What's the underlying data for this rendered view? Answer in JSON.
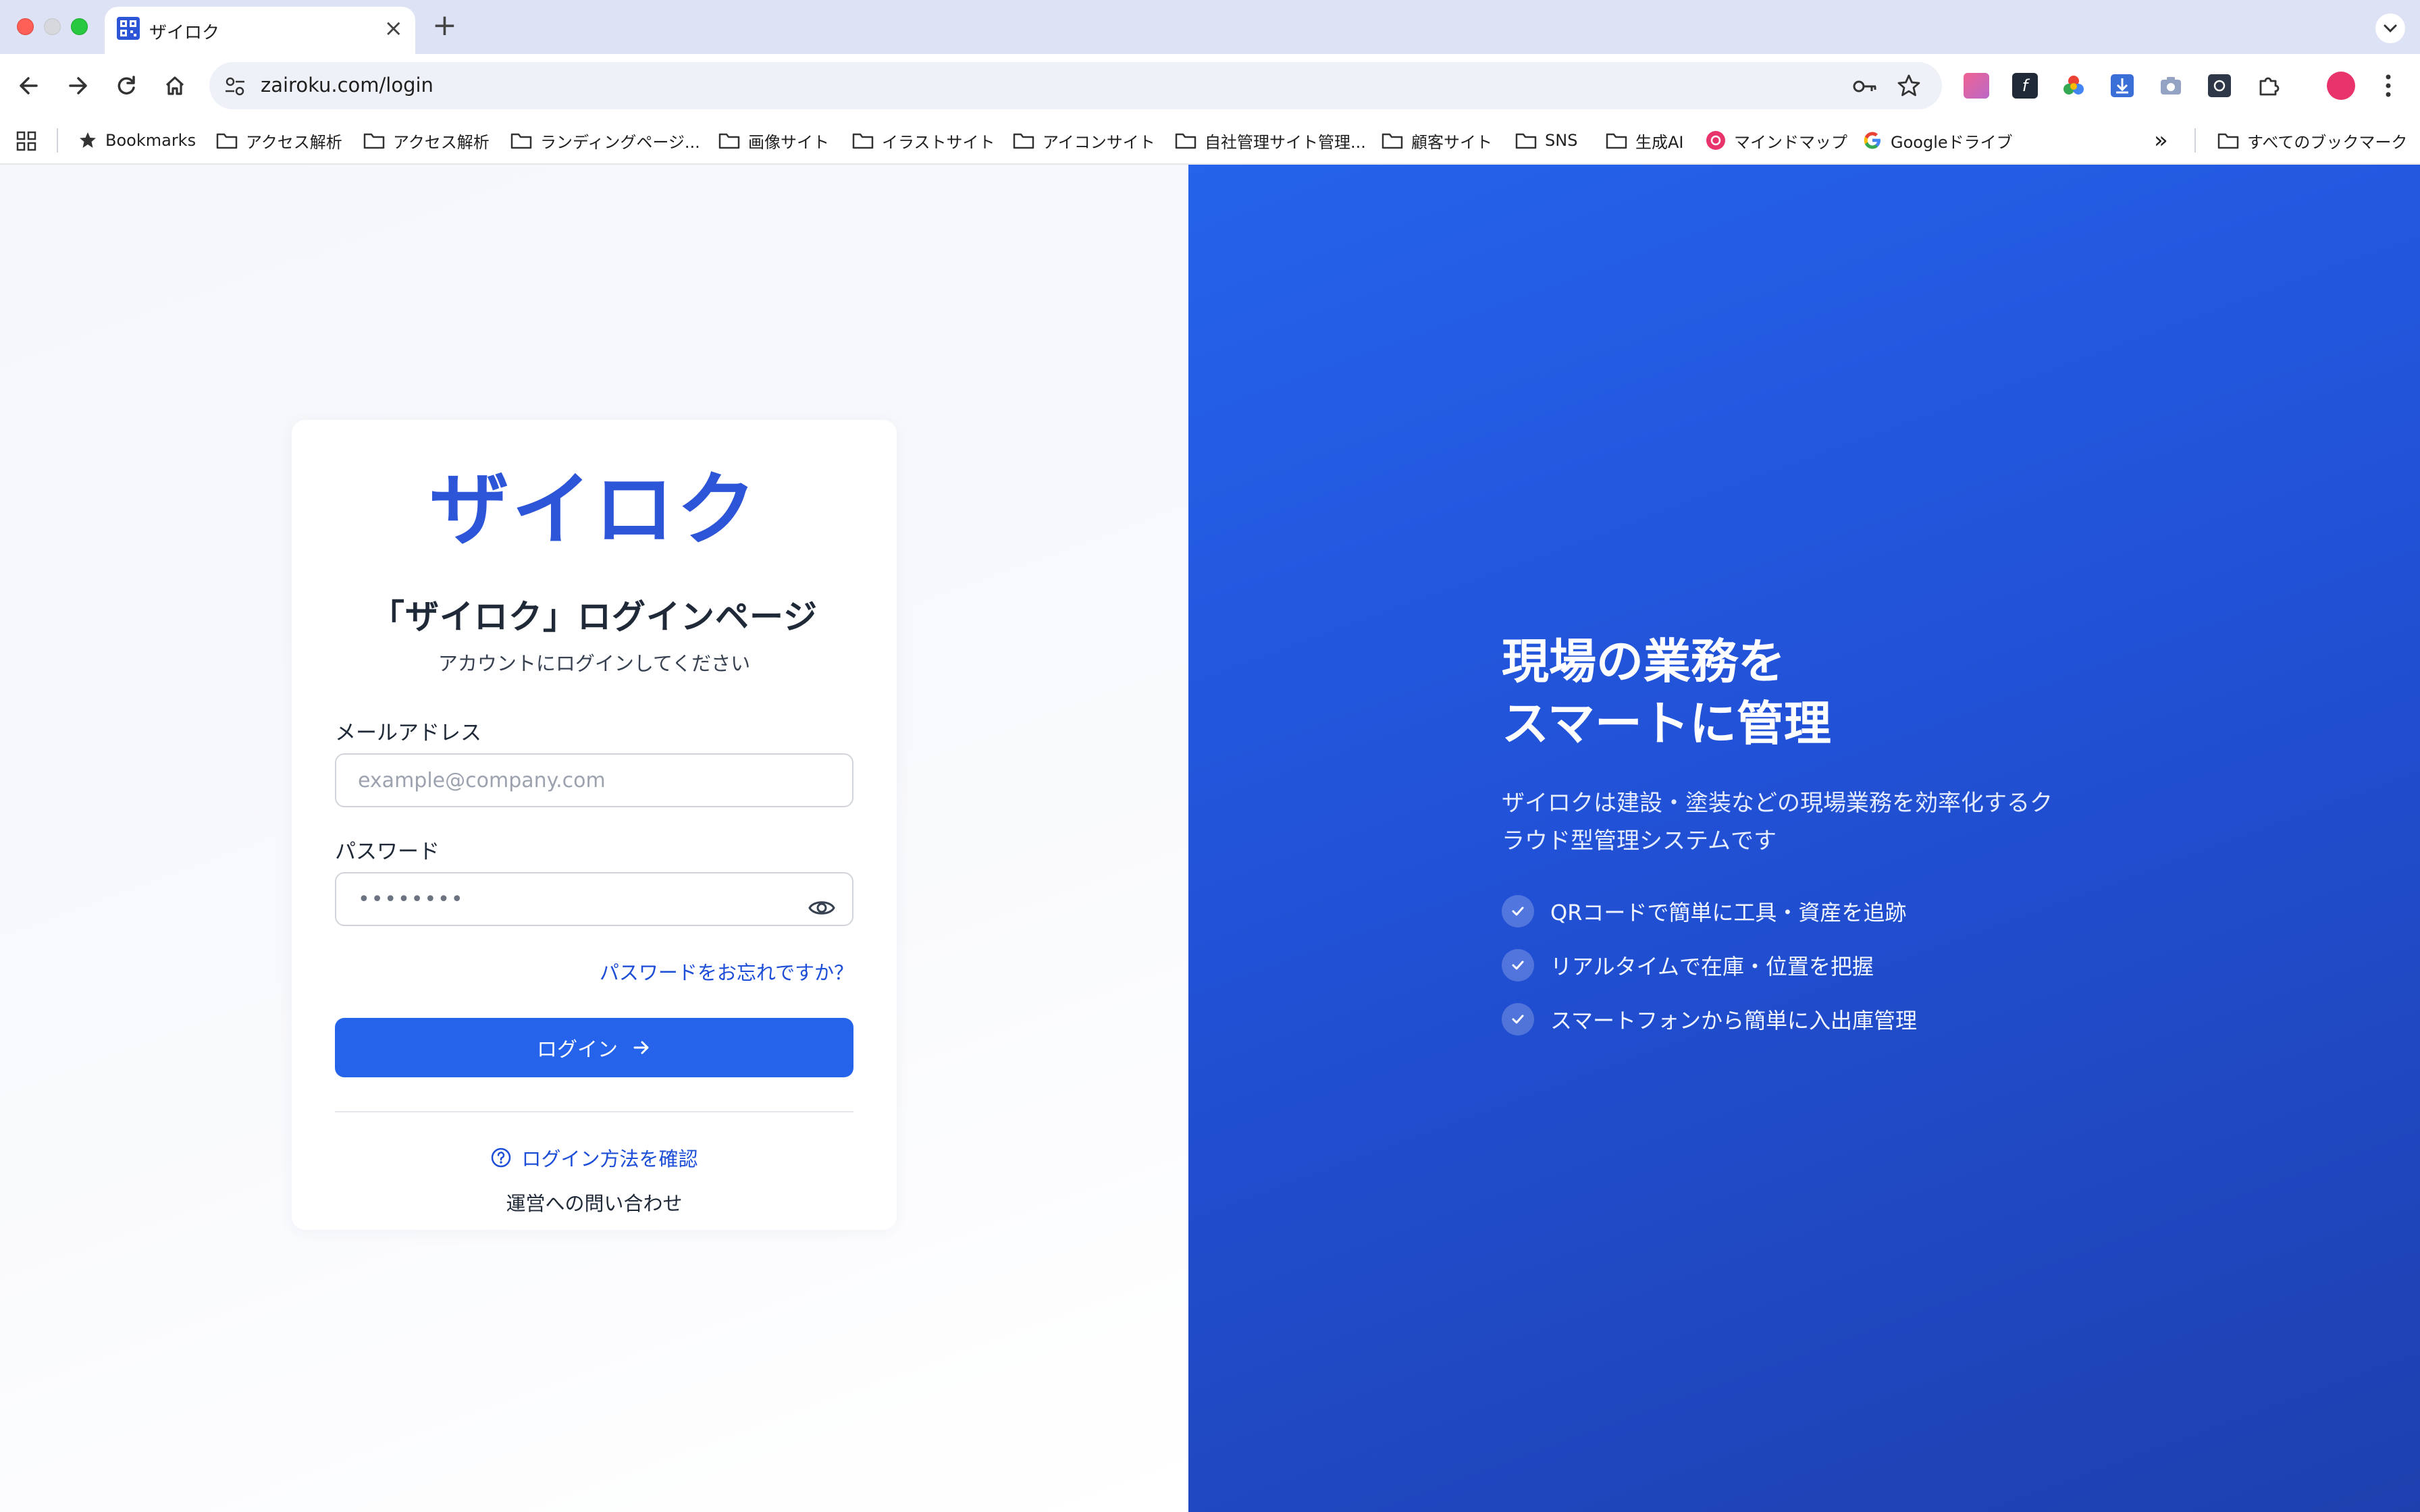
{
  "browser": {
    "tab_title": "ザイロク",
    "tab_close": "×",
    "new_tab": "+",
    "url": "zairoku.com/login",
    "bookmarks": [
      {
        "label": "Bookmarks",
        "icon": "star-icon"
      },
      {
        "label": "アクセス解析",
        "icon": "folder-icon"
      },
      {
        "label": "アクセス解析",
        "icon": "folder-icon"
      },
      {
        "label": "ランディングページ...",
        "icon": "folder-icon"
      },
      {
        "label": "画像サイト",
        "icon": "folder-icon"
      },
      {
        "label": "イラストサイト",
        "icon": "folder-icon"
      },
      {
        "label": "アイコンサイト",
        "icon": "folder-icon"
      },
      {
        "label": "自社管理サイト管理...",
        "icon": "folder-icon"
      },
      {
        "label": "顧客サイト",
        "icon": "folder-icon"
      },
      {
        "label": "SNS",
        "icon": "folder-icon"
      },
      {
        "label": "生成AI",
        "icon": "folder-icon"
      },
      {
        "label": "マインドマップ",
        "icon": "mindmap-icon"
      },
      {
        "label": "Googleドライブ",
        "icon": "google-icon"
      }
    ],
    "all_bookmarks": "すべてのブックマーク",
    "overflow": "»"
  },
  "login": {
    "logo_text": "ザイロク",
    "title": "「ザイロク」ログインページ",
    "subtitle": "アカウントにログインしてください",
    "email_label": "メールアドレス",
    "email_placeholder": "example@company.com",
    "password_label": "パスワード",
    "password_value": "••••••••",
    "forgot": "パスワードをお忘れですか？",
    "submit": "ログイン",
    "howto": "ログイン方法を確認",
    "contact": "運営への問い合わせ"
  },
  "hero": {
    "title_line1": "現場の業務を",
    "title_line2": "スマートに管理",
    "desc_line1": "ザイロクは建設・塗装などの現場業務を効率化するク",
    "desc_line2": "ラウド型管理システムです",
    "features": [
      "QRコードで簡単に工具・資産を追跡",
      "リアルタイムで在庫・位置を把握",
      "スマートフォンから簡単に入出庫管理"
    ]
  },
  "colors": {
    "primary": "#2563eb",
    "link": "#1d4ed8",
    "logo": "#2c55d8"
  }
}
